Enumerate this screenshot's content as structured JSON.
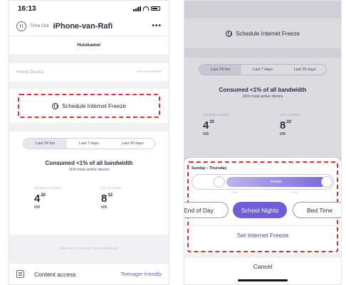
{
  "left": {
    "status": {
      "time": "16:13"
    },
    "header": {
      "timeout_label": "Time Out",
      "device_name": "iPhone-van-Rafi",
      "more": "•••"
    },
    "room": "Huiskamer",
    "home_device": {
      "label": "Home Device",
      "value": "••••••••••"
    },
    "schedule_label": "Schedule Internet Freeze",
    "tabs": [
      "Last 24 hrs",
      "Last 7 days",
      "Last 30 days"
    ],
    "active_tab": 0,
    "consumed": "Consumed <1% of all bandwidth",
    "rank": "11th most active device",
    "downloaded": {
      "caption": "DOWNLOADED",
      "value": "4",
      "sup": "20",
      "unit": "MB"
    },
    "uploaded": {
      "caption": "UPLOADED",
      "value": "8",
      "sup": "33",
      "unit": "MB"
    },
    "experience_caption": "ONLINE CONTENT EXPERIENCE",
    "content": {
      "label": "Content access",
      "value": "Teenager friendly"
    }
  },
  "right": {
    "schedule_label": "Schedule Internet Freeze",
    "tabs": [
      "Last 24 hrs",
      "Last 7 days",
      "Last 30 days"
    ],
    "consumed": "Consumed <1% of all bandwidth",
    "rank": "11th most active device",
    "downloaded": {
      "caption": "DOWNLOADED",
      "value": "4",
      "sup": "20",
      "unit": "MB"
    },
    "uploaded": {
      "caption": "UPLOADED",
      "value": "8",
      "sup": "33",
      "unit": "MB"
    },
    "sheet": {
      "days": "Sunday - Thursday",
      "slider_label": "Frozen",
      "start_time": "23:00",
      "end_time": "07:00",
      "presets": [
        "End of Day",
        "School Nights",
        "Bed Time"
      ],
      "active_preset": 1,
      "set_label": "Set Internet Freeze",
      "cancel_label": "Cancel"
    }
  },
  "colors": {
    "accent": "#6e5fd6",
    "highlight_dash": "#e0312a",
    "text": "#2d2b45",
    "background": "#f1f1f4"
  }
}
